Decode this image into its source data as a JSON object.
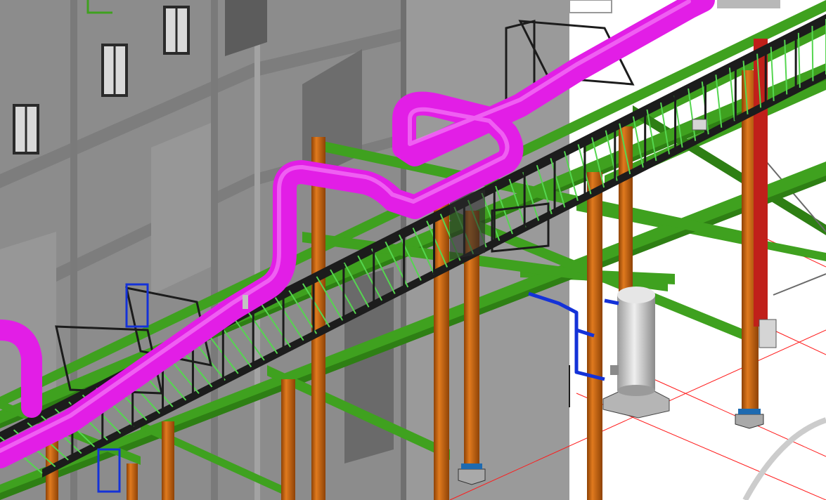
{
  "scene": {
    "kind": "3d-bim-model-viewport",
    "colors": {
      "background": "#ffffff",
      "building_wall": "#8e8e8e",
      "building_wall_dark": "#7a7a7a",
      "window": "#d9d9d9",
      "window_frame": "#2a2a2a",
      "steel_beam": "#3fa11f",
      "steel_beam_dark": "#2e7f14",
      "steel_column": "#c8620c",
      "steel_column_dark": "#8e4206",
      "column_base": "#a9a9a9",
      "pipe": "#e21ee6",
      "pipe_highlight": "#f57af7",
      "cable_tray": "#1c1c1c",
      "cable_tray_rung": "#55d650",
      "water_pipe": "#1432d8",
      "tank": "#cfcfcf",
      "tank_shade": "#9a9a9a",
      "red_grid_line": "#ff1a1a",
      "ground_arc": "#cccccc"
    },
    "objects": [
      "building-facade",
      "process-pipe",
      "cable-tray",
      "pipe-rack",
      "steel-columns",
      "vertical-tank",
      "blue-water-pipe",
      "grid-lines",
      "ground-arc"
    ]
  }
}
